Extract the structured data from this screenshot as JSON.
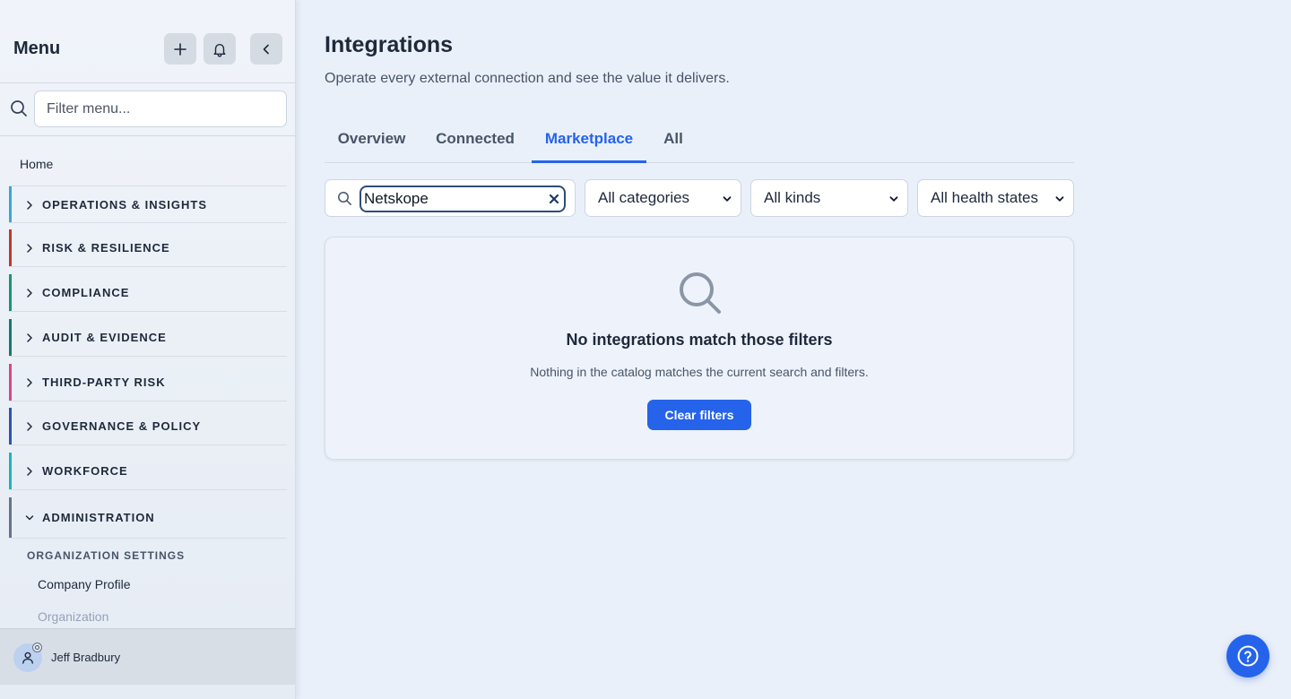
{
  "sidebar": {
    "title": "Menu",
    "filter_placeholder": "Filter menu...",
    "home_label": "Home",
    "sections": [
      {
        "label": "OPERATIONS & INSIGHTS",
        "color": "#3aa5d8",
        "expanded": false
      },
      {
        "label": "RISK & RESILIENCE",
        "color": "#c0392b",
        "expanded": false
      },
      {
        "label": "COMPLIANCE",
        "color": "#17957a",
        "expanded": false
      },
      {
        "label": "AUDIT & EVIDENCE",
        "color": "#167a6e",
        "expanded": false
      },
      {
        "label": "THIRD-PARTY RISK",
        "color": "#d9468a",
        "expanded": false
      },
      {
        "label": "GOVERNANCE & POLICY",
        "color": "#2d52b8",
        "expanded": false
      },
      {
        "label": "WORKFORCE",
        "color": "#1fb3b8",
        "expanded": false
      },
      {
        "label": "ADMINISTRATION",
        "color": "#64748b",
        "expanded": true
      }
    ],
    "subsection_heading": "ORGANIZATION SETTINGS",
    "sub_items": [
      "Company Profile",
      "Organization"
    ],
    "user_name": "Jeff Bradbury"
  },
  "main": {
    "title": "Integrations",
    "subtitle": "Operate every external connection and see the value it delivers.",
    "tabs": [
      {
        "label": "Overview",
        "active": false
      },
      {
        "label": "Connected",
        "active": false
      },
      {
        "label": "Marketplace",
        "active": true
      },
      {
        "label": "All",
        "active": false
      }
    ],
    "search_value": "Netskope",
    "filters": {
      "category": "All categories",
      "kind": "All kinds",
      "health": "All health states"
    },
    "empty_state": {
      "title": "No integrations match those filters",
      "description": "Nothing in the catalog matches the current search and filters.",
      "button_label": "Clear filters"
    }
  },
  "colors": {
    "accent": "#2563eb",
    "background": "#eaf0f9"
  }
}
